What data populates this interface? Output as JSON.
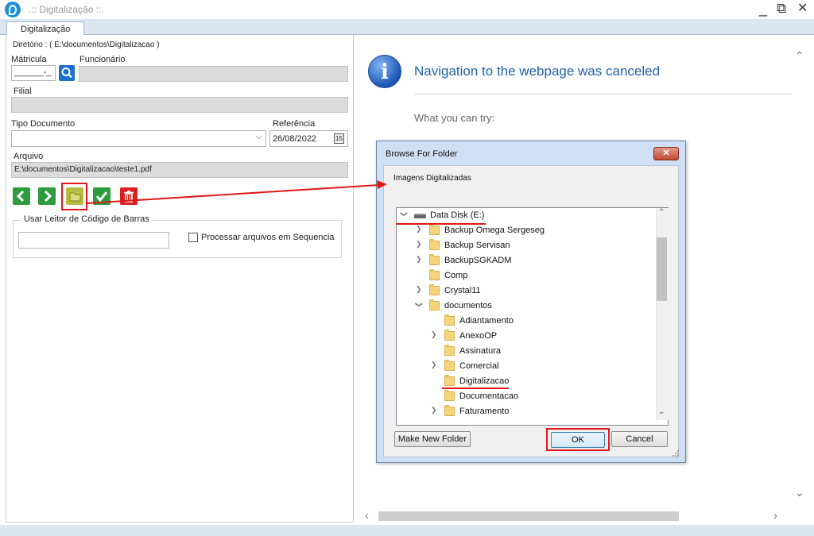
{
  "window": {
    "title": ".:: Digitalização ::.",
    "minimize_glyph": "_",
    "restore_glyph": "⧉",
    "close_glyph": "✕",
    "tab": "Digitalização"
  },
  "form": {
    "group_directory": "Diretório : ( E:\\documentos\\Digitalizacao )",
    "matricula_label": "Mátricula",
    "matricula_value": "______-_",
    "funcionario_label": "Funcionário",
    "filial_label": "Filial",
    "tipo_documento_label": "Tipo Documento",
    "referencia_label": "Referência",
    "referencia_value": "26/08/2022",
    "calendar_glyph": "15",
    "arquivo_label": "Arquivo",
    "arquivo_value": "E:\\documentos\\Digitalizacao\\teste1.pdf",
    "barcode_group": "Usar Leitor de Código de Barras",
    "process_sequence_label": "Processar arquivos em Sequencia"
  },
  "browser": {
    "message_title": "Navigation to the webpage was canceled",
    "try_text": "What you can try:"
  },
  "dialog": {
    "title": "Browse For Folder",
    "close_glyph": "✕",
    "description": "Imagens Digitalizadas",
    "tree": [
      {
        "label": "Data Disk  (E:)",
        "icon": "drive-icon",
        "expander": "open"
      },
      {
        "label": "Backup Omega Sergeseg",
        "icon": "folder-icon",
        "expander": "closed"
      },
      {
        "label": "Backup Servisan",
        "icon": "folder-icon",
        "expander": "closed"
      },
      {
        "label": "BackupSGKADM",
        "icon": "folder-icon",
        "expander": "closed"
      },
      {
        "label": "Comp",
        "icon": "folder-icon",
        "expander": "none"
      },
      {
        "label": "Crystal11",
        "icon": "folder-icon",
        "expander": "closed"
      },
      {
        "label": "documentos",
        "icon": "folder-icon",
        "expander": "open"
      },
      {
        "label": "Adiantamento",
        "icon": "folder-icon",
        "expander": "none"
      },
      {
        "label": "AnexoOP",
        "icon": "folder-icon",
        "expander": "closed"
      },
      {
        "label": "Assinatura",
        "icon": "folder-icon",
        "expander": "none"
      },
      {
        "label": "Comercial",
        "icon": "folder-icon",
        "expander": "closed"
      },
      {
        "label": "Digitalizacao",
        "icon": "folder-icon",
        "expander": "none"
      },
      {
        "label": "Documentacao",
        "icon": "folder-icon",
        "expander": "none"
      },
      {
        "label": "Faturamento",
        "icon": "folder-icon",
        "expander": "closed"
      }
    ],
    "make_new_folder": "Make New Folder",
    "ok": "OK",
    "cancel": "Cancel"
  },
  "colors": {
    "nav_title": "#1f62a8",
    "annotation_red": "#e01818",
    "icon_green": "#2e9b3e",
    "icon_blue": "#1a6fd0",
    "icon_red": "#d92020",
    "folder_button": "#b9bd3e"
  }
}
